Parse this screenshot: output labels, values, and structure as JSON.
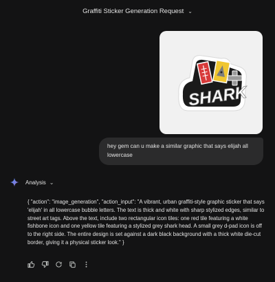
{
  "header": {
    "title": "Graffiti Sticker Generation Request"
  },
  "uploaded_image": {
    "graffiti_text": "SHARK",
    "tile_text": "SHARK"
  },
  "user_message": "hey gem can u make a similar graphic that says elijah all lowercase",
  "analysis": {
    "label": "Analysis"
  },
  "response_text": "{ \"action\": \"image_generation\", \"action_input\": \"A vibrant, urban graffiti-style graphic sticker that says 'elijah' in all lowercase bubble letters. The text is thick and white with sharp stylized edges, similar to street art tags. Above the text, include two rectangular icon tiles: one red tile featuring a white fishbone icon and one yellow tile featuring a stylized grey shark head. A small grey d-pad icon is off to the right side. The entire design is set against a dark black background with a thick white die-cut border, giving it a physical sticker look.\" }",
  "actions": {
    "icons": [
      "thumbs-up-icon",
      "thumbs-down-icon",
      "refresh-icon",
      "copy-icon",
      "more-vert-icon"
    ]
  },
  "colors": {
    "background": "#131314",
    "bubble": "#2b2b2c",
    "text": "#e3e3e3",
    "image_card_bg": "#f1f1f1",
    "sticker_red": "#d83a3a",
    "sticker_yellow": "#f0c630"
  }
}
